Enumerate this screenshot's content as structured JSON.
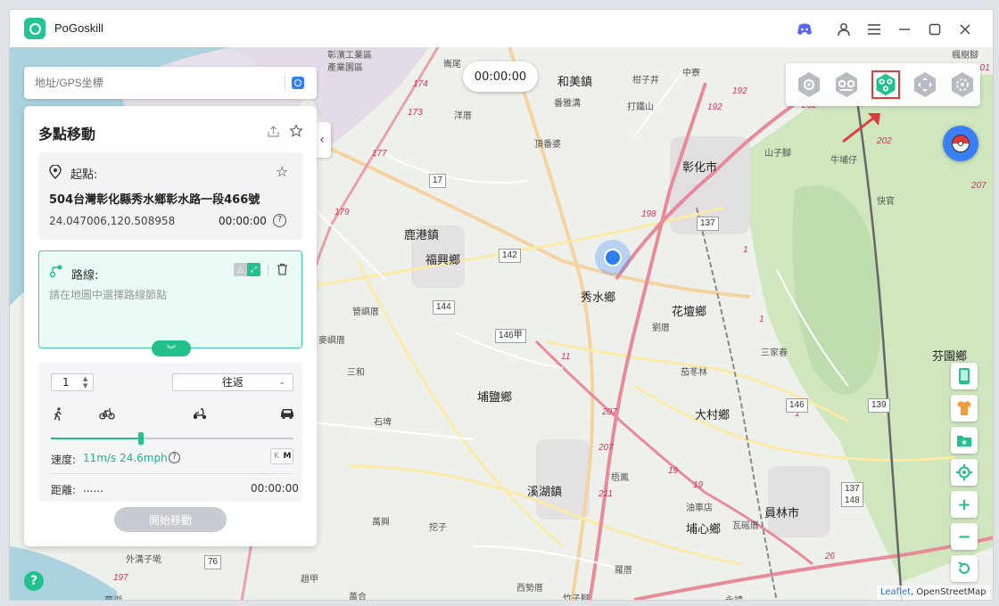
{
  "app": {
    "title": "PoGoskill"
  },
  "titlebar": {
    "icons": [
      "discord-icon",
      "user-icon",
      "menu-icon",
      "minimize-icon",
      "maximize-icon",
      "close-icon"
    ]
  },
  "search": {
    "placeholder": "地址/GPS坐標"
  },
  "timer": {
    "value": "00:00:00"
  },
  "panel": {
    "title": "多點移動",
    "start": {
      "label": "起點:",
      "address": "504台灣彰化縣秀水鄉彰水路一段466號",
      "coordinates": "24.047006,120.508958",
      "time": "00:00:00"
    },
    "route": {
      "label": "路線:",
      "hint": "請在地圖中選擇路線節點"
    },
    "settings": {
      "loop_count": "1",
      "mode": "往返",
      "speed_label": "速度:",
      "speed_value": "11m/s 24.6mph",
      "speed_fraction": 0.37,
      "unit_k": "K",
      "unit_m": "M",
      "distance_label": "距離:",
      "distance_value": "......",
      "distance_time": "00:00:00"
    },
    "start_button": "開始移動"
  },
  "map": {
    "places": [
      {
        "text": "和美鎮",
        "cls": "big"
      },
      {
        "text": "彰化市",
        "cls": "big"
      },
      {
        "text": "鹿港鎮",
        "cls": "big"
      },
      {
        "text": "福興鄉",
        "cls": "big"
      },
      {
        "text": "秀水鄉",
        "cls": "big"
      },
      {
        "text": "花壇鄉",
        "cls": "big"
      },
      {
        "text": "埔鹽鄉",
        "cls": "big"
      },
      {
        "text": "大村鄉",
        "cls": "big"
      },
      {
        "text": "芬園鄉",
        "cls": "big"
      },
      {
        "text": "溪湖鎮",
        "cls": "big"
      },
      {
        "text": "員林市",
        "cls": "big"
      },
      {
        "text": "埔心鄉",
        "cls": "big"
      },
      {
        "text": "彰濱工業區",
        "cls": "small"
      },
      {
        "text": "產業園區",
        "cls": "small"
      },
      {
        "text": "崙尾",
        "cls": "small"
      },
      {
        "text": "番雅溝",
        "cls": "small"
      },
      {
        "text": "洋厝",
        "cls": "small"
      },
      {
        "text": "頂番婆",
        "cls": "small"
      },
      {
        "text": "打鐵山",
        "cls": "small"
      },
      {
        "text": "柑子井",
        "cls": "small"
      },
      {
        "text": "中寮",
        "cls": "small"
      },
      {
        "text": "楓樹腳",
        "cls": "small"
      },
      {
        "text": "山子腳",
        "cls": "small"
      },
      {
        "text": "牛埔仔",
        "cls": "small"
      },
      {
        "text": "快官",
        "cls": "small"
      },
      {
        "text": "管嶼厝",
        "cls": "small"
      },
      {
        "text": "麥嶼厝",
        "cls": "small"
      },
      {
        "text": "三和",
        "cls": "small"
      },
      {
        "text": "劉厝",
        "cls": "small"
      },
      {
        "text": "三家春",
        "cls": "small"
      },
      {
        "text": "茄苳林",
        "cls": "small"
      },
      {
        "text": "石埤",
        "cls": "small"
      },
      {
        "text": "梧鳳",
        "cls": "small"
      },
      {
        "text": "油車店",
        "cls": "small"
      },
      {
        "text": "瓦磘厝",
        "cls": "small"
      },
      {
        "text": "萬興",
        "cls": "small"
      },
      {
        "text": "挖子",
        "cls": "small"
      },
      {
        "text": "外溝子墘",
        "cls": "small"
      },
      {
        "text": "趙甲",
        "cls": "small"
      },
      {
        "text": "萬合",
        "cls": "small"
      },
      {
        "text": "西勢厝",
        "cls": "small"
      },
      {
        "text": "竹子腳",
        "cls": "small"
      },
      {
        "text": "羅厝",
        "cls": "small"
      },
      {
        "text": "永靖",
        "cls": "small"
      },
      {
        "text": "草湖",
        "cls": "small"
      }
    ],
    "route_numbers": [
      "174",
      "173",
      "177",
      "179",
      "192",
      "192",
      "202",
      "202",
      "207",
      "198",
      "11",
      "207",
      "207",
      "19",
      "211",
      "19",
      "26",
      "26",
      "197",
      "1",
      "1",
      "1",
      "201"
    ],
    "shields": [
      "17",
      "142",
      "144",
      "146甲",
      "137",
      "146",
      "139",
      "137\n148",
      "76"
    ],
    "attribution_link": "Leaflet",
    "attribution_text": ", OpenStreetMap"
  },
  "mode_buttons": [
    "teleport-mode-icon",
    "two-spot-mode-icon",
    "multi-spot-mode-icon",
    "joystick-mode-icon",
    "scatter-mode-icon"
  ],
  "colors": {
    "accent": "#22c08c",
    "highlight": "#e03b3b",
    "marker": "#2f7ff0"
  }
}
